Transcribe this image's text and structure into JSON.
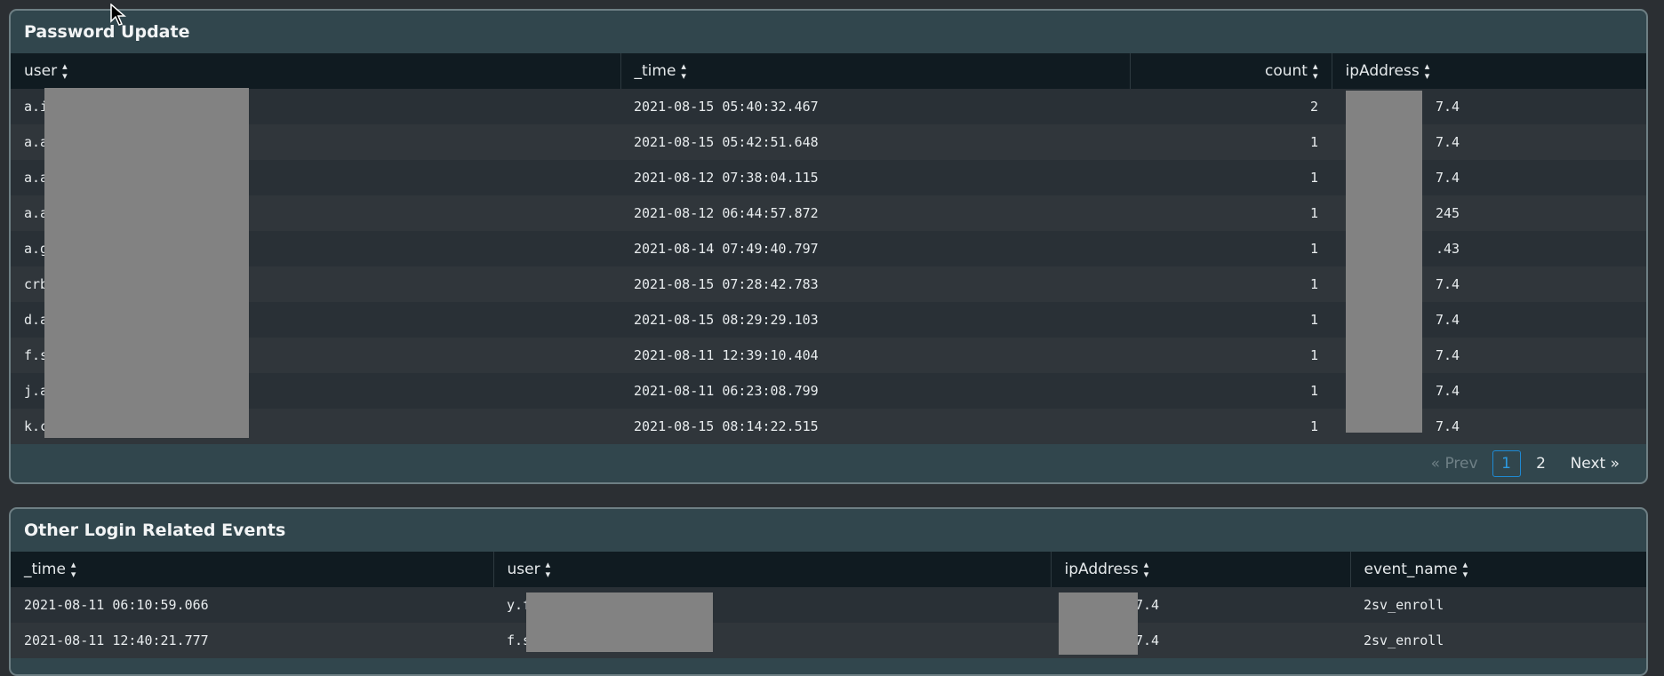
{
  "panel1": {
    "title": "Password Update",
    "columns": [
      "user",
      "_time",
      "count",
      "ipAddress"
    ],
    "rows": [
      {
        "user": "a.i",
        "time": "2021-08-15 05:40:32.467",
        "count": "2",
        "ip": "7.4"
      },
      {
        "user": "a.a",
        "time": "2021-08-15 05:42:51.648",
        "count": "1",
        "ip": "7.4"
      },
      {
        "user": "a.a",
        "time": "2021-08-12 07:38:04.115",
        "count": "1",
        "ip": "7.4"
      },
      {
        "user": "a.a",
        "time": "2021-08-12 06:44:57.872",
        "count": "1",
        "ip": "245"
      },
      {
        "user": "a.g",
        "time": "2021-08-14 07:49:40.797",
        "count": "1",
        "ip": ".43"
      },
      {
        "user": "crb",
        "time": "2021-08-15 07:28:42.783",
        "count": "1",
        "ip": "7.4"
      },
      {
        "user": "d.a",
        "time": "2021-08-15 08:29:29.103",
        "count": "1",
        "ip": "7.4"
      },
      {
        "user": "f.s",
        "time": "2021-08-11 12:39:10.404",
        "count": "1",
        "ip": "7.4"
      },
      {
        "user": "j.a",
        "time": "2021-08-11 06:23:08.799",
        "count": "1",
        "ip": "7.4"
      },
      {
        "user": "k.c",
        "time": "2021-08-15 08:14:22.515",
        "count": "1",
        "ip": "7.4"
      }
    ],
    "pager": {
      "prev": "« Prev",
      "pages": [
        "1",
        "2"
      ],
      "next": "Next »"
    }
  },
  "panel2": {
    "title": "Other Login Related Events",
    "columns": [
      "_time",
      "user",
      "ipAddress",
      "event_name"
    ],
    "rows": [
      {
        "time": "2021-08-11 06:10:59.066",
        "user": "y.f",
        "ip": "7.4",
        "event": "2sv_enroll"
      },
      {
        "time": "2021-08-11 12:40:21.777",
        "user": "f.s",
        "ip": "7.4",
        "event": "2sv_enroll"
      }
    ]
  },
  "icons": {
    "sort": "sort-icon",
    "cursor": "mouse-pointer-icon"
  }
}
